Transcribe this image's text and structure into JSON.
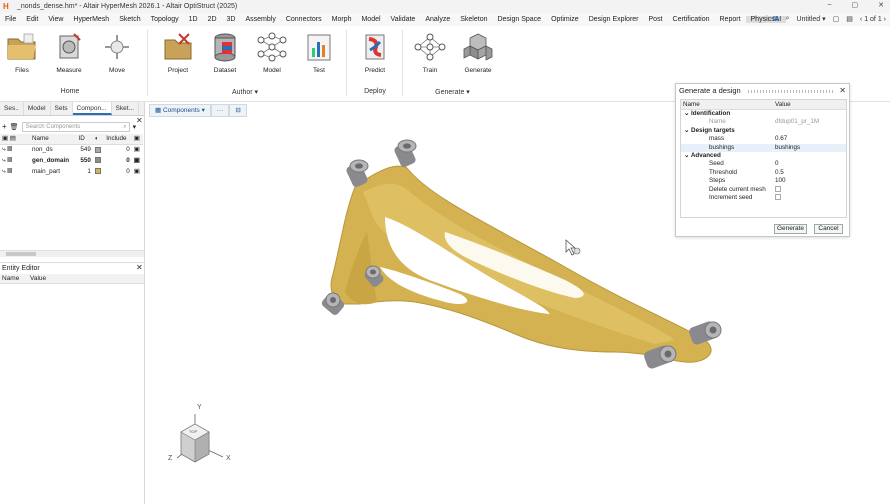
{
  "window": {
    "title": "_nonds_dense.hm* - Altair HyperMesh 2026.1 - Altair OptiStruct (2025)",
    "controls": [
      "–",
      "▢",
      "✕"
    ]
  },
  "menubar": {
    "items": [
      "File",
      "Edit",
      "View",
      "HyperMesh",
      "Sketch",
      "Topology",
      "1D",
      "2D",
      "3D",
      "Assembly",
      "Connectors",
      "Morph",
      "Model",
      "Validate",
      "Analyze",
      "Skeleton",
      "Design Space",
      "Optimize",
      "Design Explorer",
      "Post",
      "Certification",
      "Report",
      "PhysicsAI"
    ],
    "active": "PhysicsAI",
    "session": "Untitled",
    "page": "1 of 1"
  },
  "ribbon": {
    "groups": {
      "home": "Home",
      "author": "Author",
      "deploy": "Deploy",
      "generate": "Generate"
    },
    "tools": {
      "files": "Files",
      "measure": "Measure",
      "move": "Move",
      "project": "Project",
      "dataset": "Dataset",
      "model": "Model",
      "test": "Test",
      "predict": "Predict",
      "train": "Train",
      "generate": "Generate"
    }
  },
  "browser": {
    "tabs": [
      "Ses..",
      "Model",
      "Sets",
      "Compon...",
      "Sket..."
    ],
    "active_tab": "Compon...",
    "search_placeholder": "Search Components",
    "columns": [
      "Name",
      "ID",
      "Include"
    ],
    "rows": [
      {
        "name": "non_ds",
        "id": "549",
        "include": "0",
        "color": "#a8a8a8"
      },
      {
        "name": "gen_domain",
        "id": "550",
        "include": "0",
        "color": "#8d8d8d"
      },
      {
        "name": "main_part",
        "id": "1",
        "include": "0",
        "color": "#d9b24a"
      }
    ]
  },
  "entity_editor": {
    "title": "Entity Editor",
    "columns": [
      "Name",
      "Value"
    ]
  },
  "viewport": {
    "toolbar_label": "Components",
    "axes": {
      "x": "X",
      "y": "Y",
      "z": "Z"
    },
    "cube_label": "TOP"
  },
  "dialog": {
    "title": "Generate a design",
    "columns": [
      "Name",
      "Value"
    ],
    "sections": {
      "identification": "Identification",
      "design_targets": "Design targets",
      "advanced": "Advanced"
    },
    "fields": {
      "name_label": "Name",
      "name_value": "dfdup01_pr_1M",
      "mass_label": "mass",
      "mass_value": "0.67",
      "bushings_label": "bushings",
      "bushings_value": "bushings",
      "seed_label": "Seed",
      "seed_value": "0",
      "threshold_label": "Threshold",
      "threshold_value": "0.5",
      "steps_label": "Steps",
      "steps_value": "100",
      "delete_mesh_label": "Delete current mesh",
      "increment_seed_label": "Increment seed"
    },
    "buttons": {
      "generate": "Generate",
      "cancel": "Cancel"
    }
  },
  "colors": {
    "part": "#d9b24a",
    "bushing": "#9a9a9e",
    "accent": "#2a6ebb"
  }
}
